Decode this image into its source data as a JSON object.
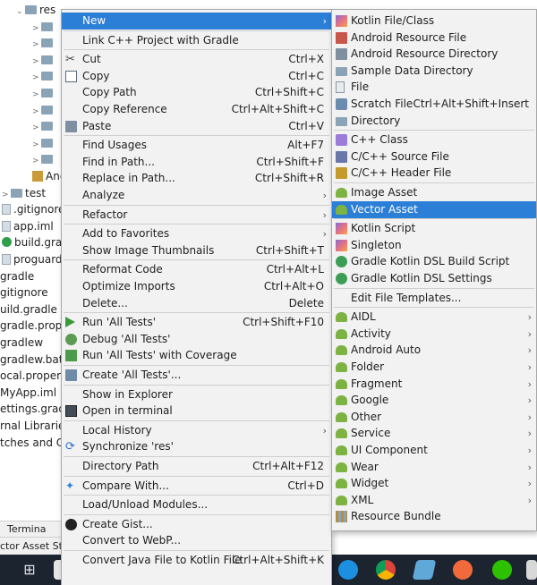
{
  "tree": {
    "items": [
      {
        "label": "res",
        "kind": "folder",
        "chev": "⌄"
      },
      {
        "label": "",
        "kind": "folder",
        "chev": ">"
      },
      {
        "label": "",
        "kind": "folder",
        "chev": ">"
      },
      {
        "label": "",
        "kind": "folder",
        "chev": ">"
      },
      {
        "label": "",
        "kind": "folder",
        "chev": ">"
      },
      {
        "label": "",
        "kind": "folder",
        "chev": ">"
      },
      {
        "label": "",
        "kind": "folder",
        "chev": ">"
      },
      {
        "label": "",
        "kind": "folder",
        "chev": ">"
      },
      {
        "label": "",
        "kind": "folder",
        "chev": ">"
      },
      {
        "label": "",
        "kind": "folder",
        "chev": ">"
      },
      {
        "label": "And",
        "kind": "kt",
        "chev": ""
      },
      {
        "label": "test",
        "kind": "folder",
        "chev": ">"
      },
      {
        "label": ".gitignore",
        "kind": "file",
        "chev": ""
      },
      {
        "label": "app.iml",
        "kind": "file",
        "chev": ""
      },
      {
        "label": "build.gradl",
        "kind": "gradle",
        "chev": ""
      },
      {
        "label": "proguard-",
        "kind": "file",
        "chev": ""
      },
      {
        "label": "gradle",
        "kind": "plain",
        "chev": ""
      },
      {
        "label": "gitignore",
        "kind": "plain",
        "chev": ""
      },
      {
        "label": "uild.gradle",
        "kind": "plain",
        "chev": ""
      },
      {
        "label": "gradle.proper",
        "kind": "plain",
        "chev": ""
      },
      {
        "label": "gradlew",
        "kind": "plain",
        "chev": ""
      },
      {
        "label": "gradlew.bat",
        "kind": "plain",
        "chev": ""
      },
      {
        "label": "ocal.propertie",
        "kind": "plain",
        "chev": ""
      },
      {
        "label": "MyApp.iml",
        "kind": "plain",
        "chev": ""
      },
      {
        "label": "ettings.gradle",
        "kind": "plain",
        "chev": ""
      },
      {
        "label": "rnal Libraries",
        "kind": "plain",
        "chev": ""
      },
      {
        "label": "tches and Co",
        "kind": "plain",
        "chev": ""
      }
    ],
    "tool_window": "Termina",
    "status_text": "ctor Asset Stu"
  },
  "context_menu": {
    "items": [
      {
        "label": "New",
        "shortcut": "",
        "submenu": true,
        "selected": true,
        "icon": ""
      },
      {
        "sep": true
      },
      {
        "label": "Link C++ Project with Gradle",
        "shortcut": "",
        "icon": ""
      },
      {
        "sep": true
      },
      {
        "label": "Cut",
        "shortcut": "Ctrl+X",
        "icon": "cut-icon"
      },
      {
        "label": "Copy",
        "shortcut": "Ctrl+C",
        "icon": "copy-icon"
      },
      {
        "label": "Copy Path",
        "shortcut": "Ctrl+Shift+C",
        "icon": ""
      },
      {
        "label": "Copy Reference",
        "shortcut": "Ctrl+Alt+Shift+C",
        "icon": ""
      },
      {
        "label": "Paste",
        "shortcut": "Ctrl+V",
        "icon": "paste-icon"
      },
      {
        "sep": true
      },
      {
        "label": "Find Usages",
        "shortcut": "Alt+F7",
        "icon": ""
      },
      {
        "label": "Find in Path...",
        "shortcut": "Ctrl+Shift+F",
        "icon": ""
      },
      {
        "label": "Replace in Path...",
        "shortcut": "Ctrl+Shift+R",
        "icon": ""
      },
      {
        "label": "Analyze",
        "shortcut": "",
        "submenu": true,
        "icon": ""
      },
      {
        "sep": true
      },
      {
        "label": "Refactor",
        "shortcut": "",
        "submenu": true,
        "icon": ""
      },
      {
        "sep": true
      },
      {
        "label": "Add to Favorites",
        "shortcut": "",
        "submenu": true,
        "icon": ""
      },
      {
        "label": "Show Image Thumbnails",
        "shortcut": "Ctrl+Shift+T",
        "icon": ""
      },
      {
        "sep": true
      },
      {
        "label": "Reformat Code",
        "shortcut": "Ctrl+Alt+L",
        "icon": ""
      },
      {
        "label": "Optimize Imports",
        "shortcut": "Ctrl+Alt+O",
        "icon": ""
      },
      {
        "label": "Delete...",
        "shortcut": "Delete",
        "icon": ""
      },
      {
        "sep": true
      },
      {
        "label": "Run 'All Tests'",
        "shortcut": "Ctrl+Shift+F10",
        "icon": "run-icon"
      },
      {
        "label": "Debug 'All Tests'",
        "shortcut": "",
        "icon": "debug-icon"
      },
      {
        "label": "Run 'All Tests' with Coverage",
        "shortcut": "",
        "icon": "coverage-icon"
      },
      {
        "sep": true
      },
      {
        "label": "Create 'All Tests'...",
        "shortcut": "",
        "icon": "create-test-icon"
      },
      {
        "sep": true
      },
      {
        "label": "Show in Explorer",
        "shortcut": "",
        "icon": ""
      },
      {
        "label": "Open in terminal",
        "shortcut": "",
        "icon": "terminal-icon"
      },
      {
        "sep": true
      },
      {
        "label": "Local History",
        "shortcut": "",
        "submenu": true,
        "icon": ""
      },
      {
        "label": "Synchronize 'res'",
        "shortcut": "",
        "icon": "sync-icon"
      },
      {
        "sep": true
      },
      {
        "label": "Directory Path",
        "shortcut": "Ctrl+Alt+F12",
        "icon": ""
      },
      {
        "sep": true
      },
      {
        "label": "Compare With...",
        "shortcut": "Ctrl+D",
        "icon": "compare-icon"
      },
      {
        "sep": true
      },
      {
        "label": "Load/Unload Modules...",
        "shortcut": "",
        "icon": ""
      },
      {
        "sep": true
      },
      {
        "label": "Create Gist...",
        "shortcut": "",
        "icon": "github-icon"
      },
      {
        "label": "Convert to WebP...",
        "shortcut": "",
        "icon": ""
      },
      {
        "sep": true
      },
      {
        "label": "Convert Java File to Kotlin File",
        "shortcut": "Ctrl+Alt+Shift+K",
        "icon": ""
      }
    ]
  },
  "new_submenu": {
    "items": [
      {
        "label": "Kotlin File/Class",
        "shortcut": "",
        "icon": "kotlin-icon"
      },
      {
        "label": "Android Resource File",
        "shortcut": "",
        "icon": "android-resource-icon"
      },
      {
        "label": "Android Resource Directory",
        "shortcut": "",
        "icon": "resource-directory-icon"
      },
      {
        "label": "Sample Data Directory",
        "shortcut": "",
        "icon": "folder-icon"
      },
      {
        "label": "File",
        "shortcut": "",
        "icon": "file-icon"
      },
      {
        "label": "Scratch File",
        "shortcut": "Ctrl+Alt+Shift+Insert",
        "icon": "scratch-icon"
      },
      {
        "label": "Directory",
        "shortcut": "",
        "icon": "folder-icon"
      },
      {
        "sep": true
      },
      {
        "label": "C++ Class",
        "shortcut": "",
        "icon": "cpp-class-icon"
      },
      {
        "label": "C/C++ Source File",
        "shortcut": "",
        "icon": "cpp-source-icon"
      },
      {
        "label": "C/C++ Header File",
        "shortcut": "",
        "icon": "cpp-header-icon"
      },
      {
        "sep": true
      },
      {
        "label": "Image Asset",
        "shortcut": "",
        "icon": "android-icon"
      },
      {
        "label": "Vector Asset",
        "shortcut": "",
        "icon": "android-icon",
        "selected": true
      },
      {
        "sep": true
      },
      {
        "label": "Kotlin Script",
        "shortcut": "",
        "icon": "kotlin-script-icon"
      },
      {
        "label": "Singleton",
        "shortcut": "",
        "icon": "singleton-icon"
      },
      {
        "label": "Gradle Kotlin DSL Build Script",
        "shortcut": "",
        "icon": "gradle-icon"
      },
      {
        "label": "Gradle Kotlin DSL Settings",
        "shortcut": "",
        "icon": "gradle-icon"
      },
      {
        "sep": true
      },
      {
        "label": "Edit File Templates...",
        "shortcut": "",
        "icon": ""
      },
      {
        "sep": true
      },
      {
        "label": "AIDL",
        "submenu": true,
        "icon": "android-icon"
      },
      {
        "label": "Activity",
        "submenu": true,
        "icon": "android-icon"
      },
      {
        "label": "Android Auto",
        "submenu": true,
        "icon": "android-icon"
      },
      {
        "label": "Folder",
        "submenu": true,
        "icon": "android-icon"
      },
      {
        "label": "Fragment",
        "submenu": true,
        "icon": "android-icon"
      },
      {
        "label": "Google",
        "submenu": true,
        "icon": "android-icon"
      },
      {
        "label": "Other",
        "submenu": true,
        "icon": "android-icon"
      },
      {
        "label": "Service",
        "submenu": true,
        "icon": "android-icon"
      },
      {
        "label": "UI Component",
        "submenu": true,
        "icon": "android-icon"
      },
      {
        "label": "Wear",
        "submenu": true,
        "icon": "android-icon"
      },
      {
        "label": "Widget",
        "submenu": true,
        "icon": "android-icon"
      },
      {
        "label": "XML",
        "submenu": true,
        "icon": "android-icon"
      },
      {
        "label": "Resource Bundle",
        "shortcut": "",
        "icon": "resource-bundle-icon"
      }
    ]
  },
  "colors": {
    "selection": "#2c7fd6",
    "menu_bg": "#f2f2f2",
    "taskbar": "#1c2430"
  },
  "taskbar_icons": [
    "windows-icon",
    "app-icon",
    "chrome-icon",
    "notes-icon",
    "browser-icon",
    "wechat-icon",
    "app2-icon"
  ]
}
